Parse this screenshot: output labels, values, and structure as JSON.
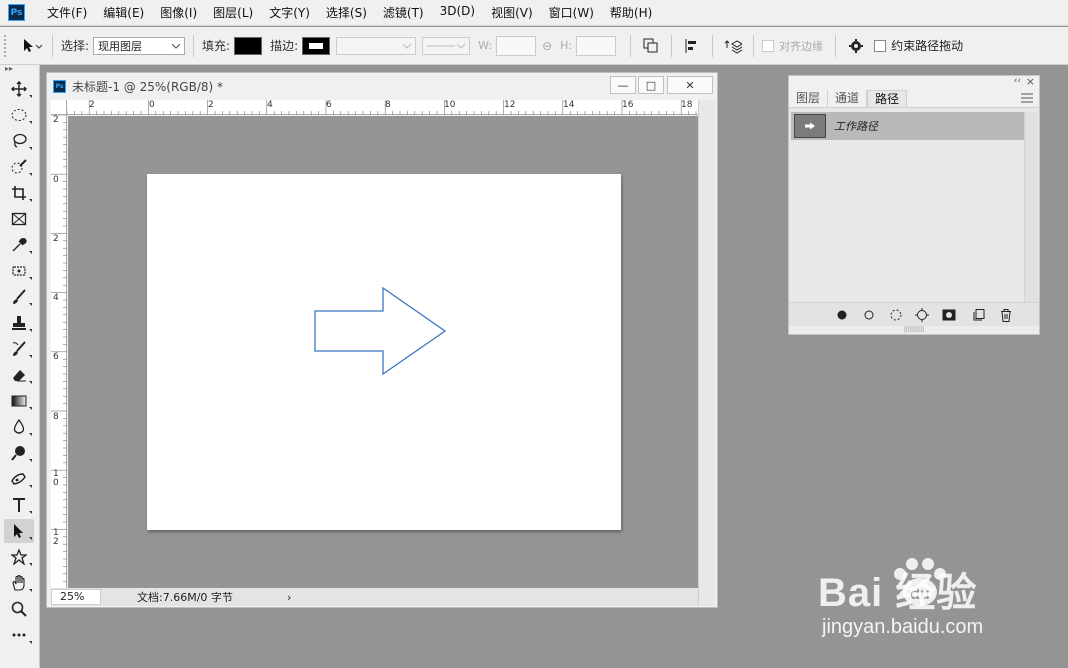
{
  "app": {
    "logo": "Ps",
    "menu": [
      "文件(F)",
      "编辑(E)",
      "图像(I)",
      "图层(L)",
      "文字(Y)",
      "选择(S)",
      "滤镜(T)",
      "3D(D)",
      "视图(V)",
      "窗口(W)",
      "帮助(H)"
    ]
  },
  "options": {
    "select_label": "选择:",
    "select_value": "现用图层",
    "fill_label": "填充:",
    "stroke_label": "描边:",
    "w_label": "W:",
    "h_label": "H:",
    "align_edges_label": "对齐边缘",
    "constrain_label": "约束路径拖动",
    "fill_color": "#000000"
  },
  "document": {
    "title": "未标题-1 @ 25%(RGB/8) *",
    "min_label": "—",
    "max_label": "□",
    "close_label": "✕",
    "ruler_top": [
      "2",
      "0",
      "2",
      "4",
      "6",
      "8",
      "10",
      "12",
      "14",
      "16",
      "18"
    ],
    "ruler_left": [
      "2",
      "0",
      "2",
      "4",
      "6",
      "8",
      "1\n0",
      "1\n2"
    ],
    "zoom": "25%",
    "info": "文档:7.66M/0 字节",
    "status_arrow": "›",
    "shape_stroke": "#3a78c2"
  },
  "panel": {
    "tabs": [
      "图层",
      "通道",
      "路径"
    ],
    "active_tab": 2,
    "path_name": "工作路径",
    "collapse_label": "‹‹",
    "close_label": "×"
  },
  "watermark": {
    "brand": "Bai  经验",
    "url": "jingyan.baidu.com"
  }
}
